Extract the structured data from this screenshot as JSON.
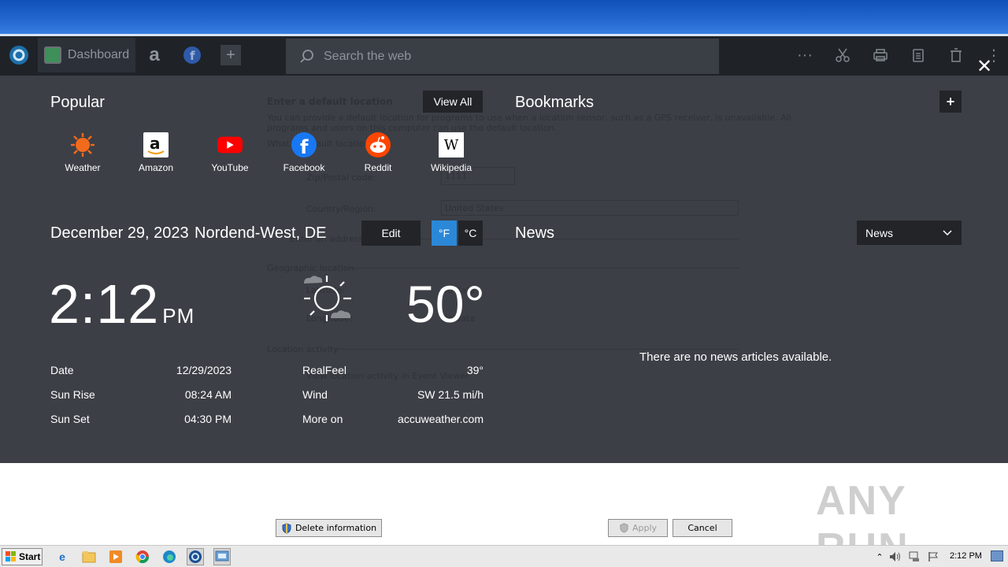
{
  "browser": {
    "tabs": [
      {
        "label": "Dashboard"
      }
    ],
    "search_placeholder": "Search the web",
    "close_glyph": "✕"
  },
  "ghost_dialog": {
    "title": "Enter a default location",
    "desc1": "You can provide a default location for programs to use when a location sensor, such as a GPS receiver, is unavailable. All",
    "desc2": "programs and users on this computer can use the default location.",
    "link": "What is default location?",
    "zip_label": "Zip/Postal code:",
    "zip_value": "1111",
    "country_label": "Country/Region:",
    "country_value": "United States",
    "address_label": "Enter an address (optional)",
    "geo_label": "Geographic location",
    "lat_label": "Latitude:",
    "long_label": "Longitude:",
    "no_data": "No data",
    "activity_label": "Location activity",
    "activity_link": "View location activity in Event Viewer"
  },
  "popular": {
    "title": "Popular",
    "view_all": "View All",
    "items": [
      {
        "label": "Weather"
      },
      {
        "label": "Amazon"
      },
      {
        "label": "YouTube"
      },
      {
        "label": "Facebook"
      },
      {
        "label": "Reddit"
      },
      {
        "label": "Wikipedia"
      }
    ]
  },
  "bookmarks": {
    "title": "Bookmarks",
    "add": "+"
  },
  "weather": {
    "date_heading": "December 29, 2023",
    "location": "Nordend-West, DE",
    "edit": "Edit",
    "unit_f": "°F",
    "unit_c": "°C",
    "time": "2:12",
    "ampm": "PM",
    "temperature": "50°",
    "stats_left": [
      {
        "label": "Date",
        "value": "12/29/2023"
      },
      {
        "label": "Sun Rise",
        "value": "08:24 AM"
      },
      {
        "label": "Sun Set",
        "value": "04:30 PM"
      }
    ],
    "stats_right": [
      {
        "label": "RealFeel",
        "value": "39°"
      },
      {
        "label": "Wind",
        "value": "SW 21.5 mi/h"
      },
      {
        "label": "More on",
        "value": "accuweather.com"
      }
    ]
  },
  "news": {
    "title": "News",
    "dropdown_value": "News",
    "empty": "There are no news articles available."
  },
  "dialog_buttons": {
    "delete": "Delete information",
    "apply": "Apply",
    "cancel": "Cancel"
  },
  "watermark": "ANY RUN",
  "taskbar": {
    "start": "Start",
    "clock": "2:12 PM"
  },
  "colors": {
    "accent": "#2b88d8",
    "overlay_bg": "#3c3f46",
    "browser_bg": "#1f2328"
  }
}
